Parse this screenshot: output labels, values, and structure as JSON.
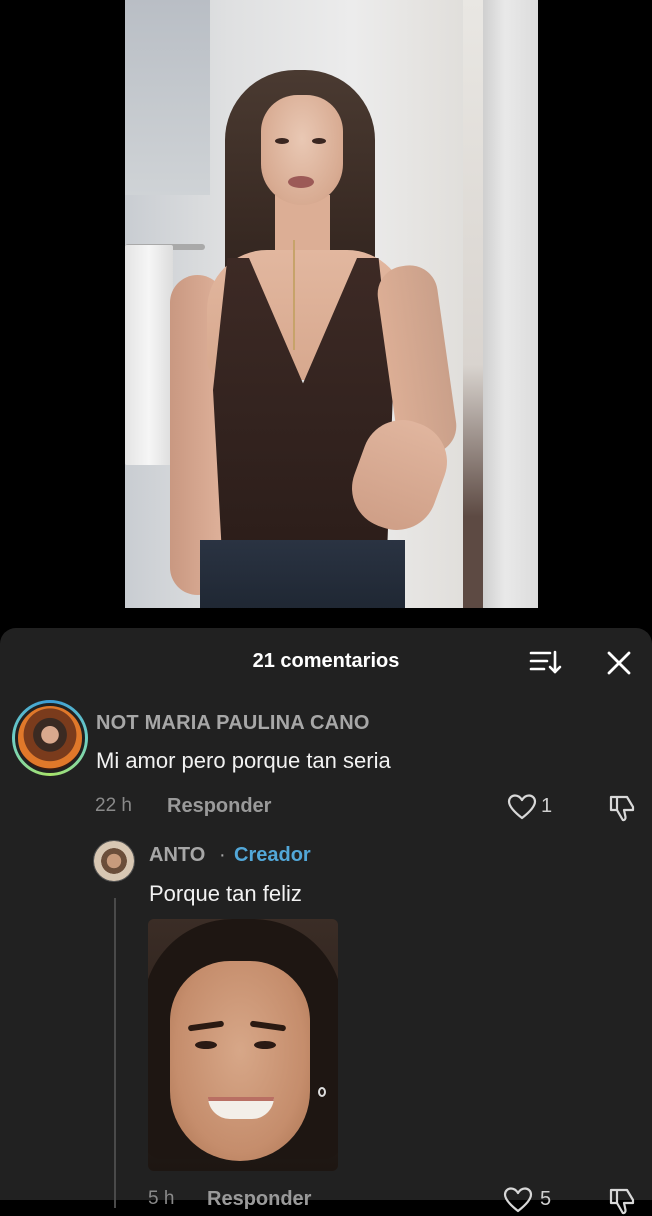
{
  "video": {
    "description_icon": "video-frame"
  },
  "comments_panel": {
    "title": "21 comentarios",
    "sort_icon": "sort-icon",
    "close_icon": "close-icon"
  },
  "comment": {
    "username": "NOT MARIA PAULINA CANO",
    "text": "Mi amor pero porque tan seria",
    "time": "22 h",
    "reply_label": "Responder",
    "like_count": "1"
  },
  "reply": {
    "username": "ANTO",
    "separator": "·",
    "creator_label": "Creador",
    "text": "Porque tan feliz",
    "time": "5 h",
    "reply_label": "Responder",
    "like_count": "5"
  },
  "colors": {
    "panel_bg": "#212121",
    "creator_accent": "#52a7d8",
    "muted_text": "#a7a7a7"
  }
}
